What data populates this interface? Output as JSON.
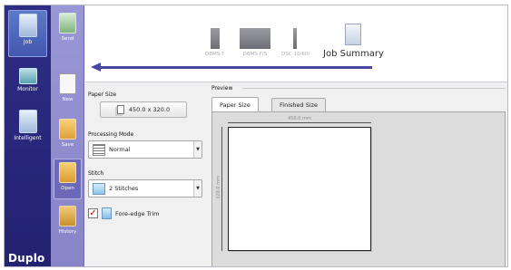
{
  "nav": {
    "job_label": "Job",
    "monitor_label": "Monitor",
    "intelligent_label": "Intelligent",
    "brand": "Duplo"
  },
  "tools": {
    "send_label": "Send",
    "new_label": "New",
    "save_label": "Save",
    "open_label": "Open",
    "history_label": "History"
  },
  "header": {
    "devices": [
      {
        "name": "DBMS-T"
      },
      {
        "name": "DBMS-F/S"
      },
      {
        "name": "DSC-10/60i"
      }
    ],
    "job_summary_label": "Job Summary"
  },
  "form": {
    "paper_size_label": "Paper Size",
    "paper_size_value": "450.0 x 320.0",
    "processing_mode_label": "Processing Mode",
    "processing_mode_value": "Normal",
    "stitch_label": "Stitch",
    "stitch_value": "2 Stitches",
    "fore_edge_trim_label": "Fore-edge Trim",
    "fore_edge_trim_checked": true
  },
  "preview": {
    "title": "Preview",
    "tabs": [
      {
        "label": "Paper Size",
        "active": true
      },
      {
        "label": "Finished Size",
        "active": false
      }
    ],
    "width_label": "450.0 mm",
    "height_label": "320.0 mm"
  },
  "colors": {
    "nav_bg": "#2e2d83",
    "tools_bg": "#9a97d6",
    "arrow": "#4946a2",
    "check_mark": "#d40000"
  }
}
